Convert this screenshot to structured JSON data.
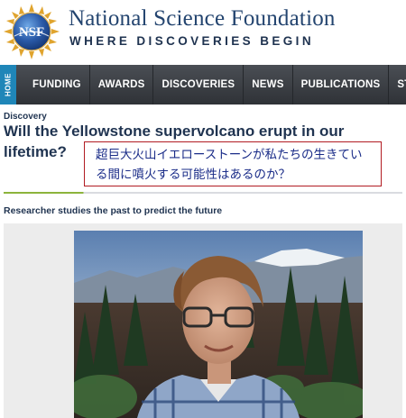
{
  "header": {
    "logo_text": "NSF",
    "org_name": "National Science Foundation",
    "tagline": "WHERE DISCOVERIES BEGIN"
  },
  "nav": {
    "home_label": "HOME",
    "items": [
      "FUNDING",
      "AWARDS",
      "DISCOVERIES",
      "NEWS",
      "PUBLICATIONS",
      "STAT"
    ]
  },
  "article": {
    "kicker": "Discovery",
    "headline": "Will the Yellowstone supervolcano erupt in our lifetime?",
    "translation": "超巨大火山イエローストーンが私たちの生きている間に噴火する可能性はあるのか？",
    "subhead": "Researcher studies the past to predict the future"
  },
  "colors": {
    "brand_navy": "#23446f",
    "nav_bg": "#3b3f44",
    "home_tab": "#1f86b8",
    "accent_green": "#8cb43c",
    "translation_border": "#b11b22",
    "translation_text": "#1a2c88"
  }
}
